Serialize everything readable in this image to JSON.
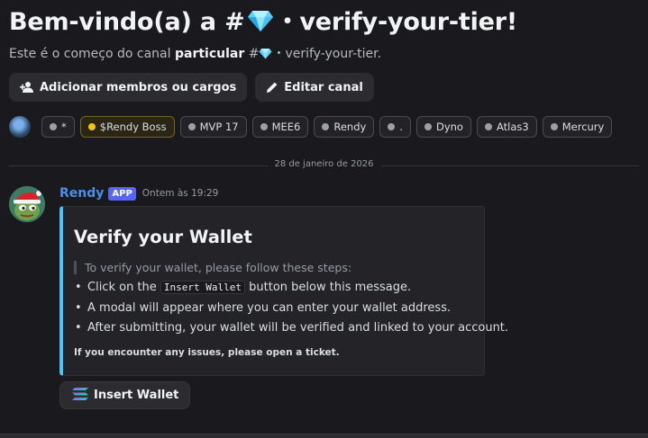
{
  "channel": {
    "welcome_prefix": "Bem-vindo(a) a #",
    "welcome_suffix": "・verify-your-tier!",
    "start_prefix": "Este é o começo do canal",
    "start_bold": "particular",
    "start_hash": "#",
    "start_suffix": "・verify-your-tier.",
    "gem_icon": "diamond-icon"
  },
  "actions": {
    "add_members_label": "Adicionar membros ou cargos",
    "edit_channel_label": "Editar canal"
  },
  "roles": [
    {
      "label": "*"
    },
    {
      "label": "$Rendy Boss"
    },
    {
      "label": "MVP 17"
    },
    {
      "label": "MEE6"
    },
    {
      "label": "Rendy"
    },
    {
      "label": "."
    },
    {
      "label": "Dyno"
    },
    {
      "label": "Atlas3"
    },
    {
      "label": "Mercury"
    }
  ],
  "date_divider": "28 de janeiro de 2026",
  "message": {
    "author": "Rendy",
    "badge": "APP",
    "timestamp": "Ontem às 19:29",
    "embed": {
      "accent_color": "#4fc3f7",
      "title": "Verify your Wallet",
      "quote": "To verify your wallet, please follow these steps:",
      "step1_prefix": "Click on the",
      "step1_code": "Insert Wallet",
      "step1_suffix": "button below this message.",
      "step2": "A modal will appear where you can enter your wallet address.",
      "step3": "After submitting, your wallet will be verified and linked to your account.",
      "footer": "If you encounter any issues, please open a ticket."
    },
    "button_label": "Insert Wallet"
  },
  "colors": {
    "background": "#1a1a1e",
    "author": "#4b8ee8",
    "app_badge": "#5865f2",
    "gold_role": "#f0c419"
  }
}
